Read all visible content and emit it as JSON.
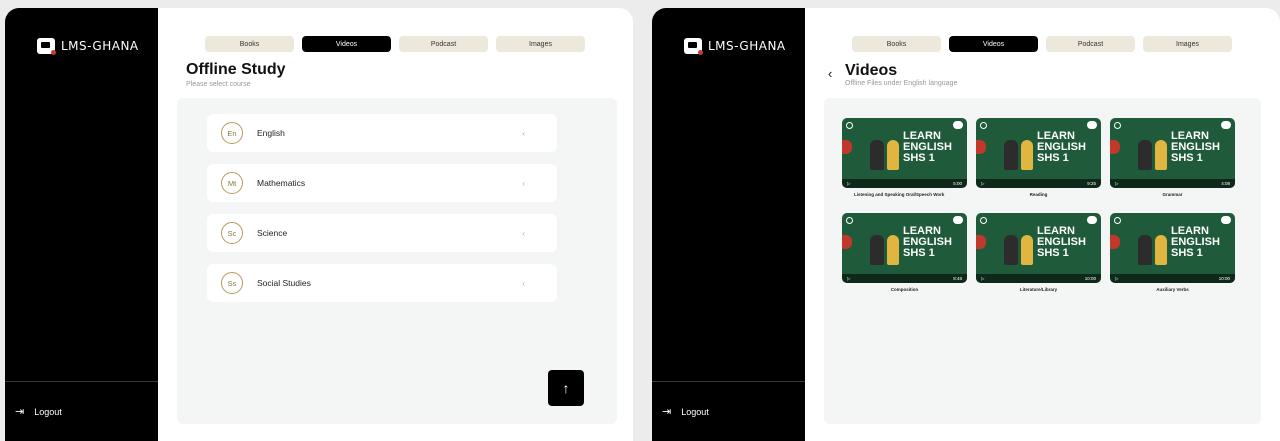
{
  "brand": {
    "name": "LMS-GHANA"
  },
  "tabs": [
    "Books",
    "Videos",
    "Podcast",
    "Images"
  ],
  "active_tab": "Videos",
  "sidebar": {
    "logout_label": "Logout"
  },
  "screen1": {
    "title": "Offline Study",
    "subtitle": "Please select course",
    "courses": [
      {
        "badge": "En",
        "name": "English"
      },
      {
        "badge": "Mt",
        "name": "Mathematics"
      },
      {
        "badge": "Sc",
        "name": "Science"
      },
      {
        "badge": "Ss",
        "name": "Social Studies"
      }
    ],
    "fab_icon": "arrow-up-icon"
  },
  "screen2": {
    "title": "Videos",
    "subtitle": "Offline Files under English language",
    "thumbnail_text": [
      "LEARN",
      "ENGLISH",
      "SHS 1"
    ],
    "videos": [
      {
        "label": "Listening and Speaking Oral/Speech Work",
        "duration": "5:00"
      },
      {
        "label": "Reading",
        "duration": "9:25"
      },
      {
        "label": "Grammar",
        "duration": "4:08"
      },
      {
        "label": "Composition",
        "duration": "8:48"
      },
      {
        "label": "Literature/Library",
        "duration": "10:00"
      },
      {
        "label": "Auxiliary Verbs",
        "duration": "10:00"
      }
    ]
  },
  "colors": {
    "accent": "#000000",
    "badge_gold": "#b49a5e",
    "thumb_green": "#1f5a3a"
  }
}
